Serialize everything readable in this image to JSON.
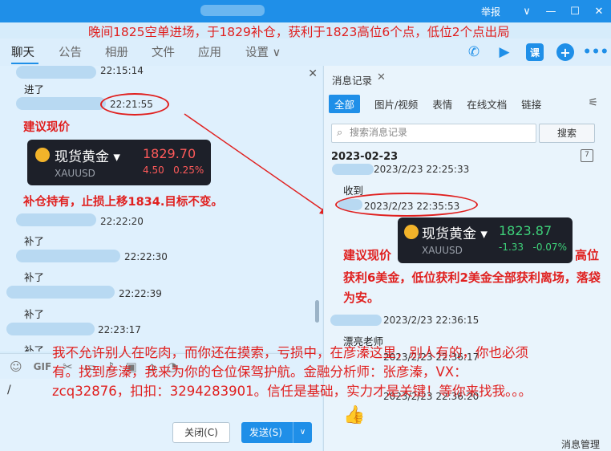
{
  "titlebar": {
    "report": "举报",
    "buttons": {
      "dropdown": "∨",
      "minimize": "—",
      "maximize": "☐",
      "close": "✕"
    },
    "overlay_text": "晚间1825空单进场，于1829补仓，获利于1823高位6个点，低位2个点出局"
  },
  "tabs": [
    "聊天",
    "公告",
    "相册",
    "文件",
    "应用",
    "设置 ∨"
  ],
  "chat": {
    "messages": [
      {
        "time": "22:15:14"
      },
      {
        "text": "进了"
      },
      {
        "time": "22:21:55"
      },
      {
        "time": "22:22:20"
      },
      {
        "text": "补了"
      },
      {
        "time": "22:22:30"
      },
      {
        "text": "补了"
      },
      {
        "time": "22:22:39"
      },
      {
        "text": "补了"
      },
      {
        "time": "22:23:17"
      },
      {
        "text": "补了"
      }
    ],
    "red_label_1": "建议现价",
    "red_label_2": "补仓持有，止损上移1834.目标不变。"
  },
  "stock_left": {
    "name": "现货黄金 ▾",
    "code": "XAUUSD",
    "price": "1829.70",
    "change": "4.50",
    "change_pct": "0.25%",
    "color": "#ff5a5a"
  },
  "stock_right": {
    "name": "现货黄金 ▾",
    "code": "XAUUSD",
    "price": "1823.87",
    "change": "-1.33",
    "change_pct": "-0.07%",
    "color": "#3ed27a"
  },
  "input": {
    "tool_icons": [
      "☺",
      "GIF",
      "✂",
      "▭",
      "♪",
      "▣",
      "⌂",
      "◔"
    ],
    "cursor": "/",
    "close_label": "关闭(C)",
    "send_label": "发送(S)",
    "send_arrow": "∨"
  },
  "bottom_overlay": "我不允许别人在吃肉，而你还在摸索，亏损中，在彦溱这里，别人有的，你也必须有。找到彦溱，我来为你的仓位保驾护航。金融分析师：张彦溱，VX：zcq32876，扣扣：3294283901。信任是基础，实力才是关键！等你来找我。。。",
  "history": {
    "title": "消息记录",
    "title_close": "✕",
    "tabs": [
      "全部",
      "图片/视频",
      "表情",
      "在线文档",
      "链接"
    ],
    "search_placeholder": "搜索消息记录",
    "search_button": "搜索",
    "date": "2023-02-23",
    "calendar_day": "7",
    "entries": [
      {
        "time": "2023/2/23 22:25:33"
      },
      {
        "text": "收到"
      },
      {
        "time": "2023/2/23 22:35:53"
      },
      {
        "time": "2023/2/23 22:36:15"
      },
      {
        "text": "漂亮老师"
      },
      {
        "time": "2023/2/23 22:36:17"
      },
      {
        "time": "2023/2/23 22:36:20"
      }
    ],
    "red_label": "建议现价",
    "red_high": "高位",
    "red_body": "获利6美金，低位获利2美金全部获利离场，落袋为安。",
    "footer": "消息管理"
  }
}
